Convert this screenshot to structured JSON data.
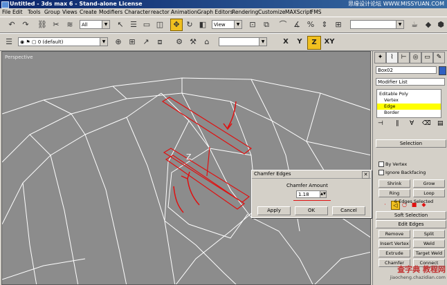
{
  "window": {
    "title": "Untitled - 3ds max 6 - Stand-alone License",
    "watermark": "思缘设计论坛 WWW.MISSYUAN.COM"
  },
  "menu": [
    "File",
    "Edit",
    "Tools",
    "Group",
    "Views",
    "Create",
    "Modifiers",
    "Character",
    "reactor",
    "Animation",
    "Graph Editors",
    "Rendering",
    "Customize",
    "MAXScript",
    "FMS"
  ],
  "toolbar1": {
    "selection_filter": "All",
    "ref_coord": "View",
    "icons": [
      "undo-icon",
      "redo-icon",
      "link-icon",
      "unlink-icon",
      "bind-space-warp-icon",
      "select-icon",
      "select-by-name-icon",
      "rect-region-icon",
      "crossing-icon",
      "move-icon",
      "rotate-icon",
      "scale-icon",
      "pivot-icon",
      "mirror-icon",
      "align-icon",
      "snap-icon",
      "angle-snap-icon",
      "percent-snap-icon",
      "spinner-snap-icon",
      "named-sets-icon",
      "render-icon",
      "quick-render-icon"
    ]
  },
  "toolbar2": {
    "layer": "0 (default)",
    "axis_buttons": [
      "X",
      "Y",
      "Z",
      "XY"
    ],
    "active_axis": "Z"
  },
  "viewport": {
    "label": "Perspective"
  },
  "chamfer_dialog": {
    "title": "Chamfer Edges",
    "amount_label": "Chamfer Amount",
    "amount_value": "1.18",
    "buttons": [
      "Apply",
      "OK",
      "Cancel"
    ]
  },
  "command_panel": {
    "object_name": "Box02",
    "modifier_list": "Modifier List",
    "stack": [
      {
        "label": "Editable Poly",
        "selected": false
      },
      {
        "label": "Vertex",
        "selected": false
      },
      {
        "label": "Edge",
        "selected": true
      },
      {
        "label": "Border",
        "selected": false
      }
    ],
    "selection": {
      "header": "Selection",
      "by_vertex": "By Vertex",
      "ignore_backfacing": "Ignore Backfacing",
      "buttons": [
        "Shrink",
        "Grow",
        "Ring",
        "Loop"
      ],
      "status": "6 Edges Selected"
    },
    "soft_selection_header": "Soft Selection",
    "edit_edges": {
      "header": "Edit Edges",
      "buttons": [
        "Remove",
        "Split",
        "Insert Vertex",
        "Weld",
        "Extrude",
        "Target Weld",
        "Chamfer",
        "Connect"
      ]
    }
  },
  "site_watermark": "查字典 教程网",
  "site_watermark_url": "jiaocheng.chazidian.com",
  "colors": {
    "highlight_yellow": "#f0c020",
    "stack_selected": "#ffff00",
    "annotation_red": "#e01010",
    "viewport_bg": "#8c8c8c"
  }
}
